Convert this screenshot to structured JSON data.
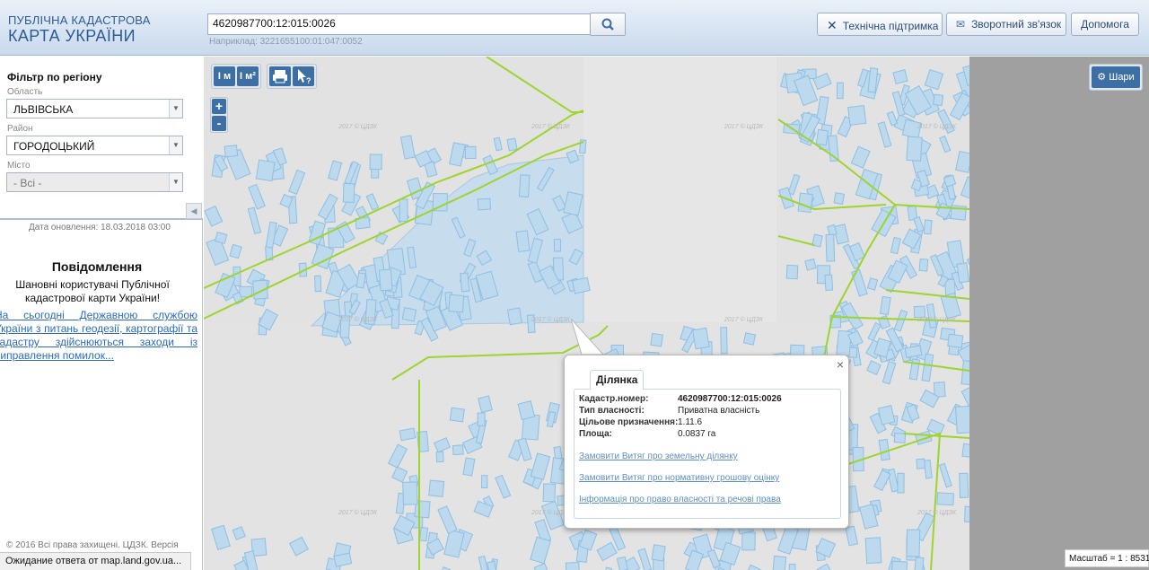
{
  "header": {
    "logo_line1": "ПУБЛІЧНА КАДАСТРОВА",
    "logo_line2": "КАРТА УКРАЇНИ",
    "search_value": "4620987700:12:015:0026",
    "search_hint": "Наприклад: 3221655100:01:047:0052",
    "search_icon": "search-icon",
    "buttons": [
      {
        "label": "Технічна підтримка",
        "icon": "tools-icon"
      },
      {
        "label": "Зворотний зв'язок",
        "icon": "envelope-icon"
      },
      {
        "label": "Допомога"
      }
    ]
  },
  "sidebar": {
    "filter_title": "Фільтр по регіону",
    "region_label": "Область",
    "region_value": "ЛЬВІВСЬКА",
    "district_label": "Район",
    "district_value": "ГОРОДОЦЬКИЙ",
    "city_label": "Місто",
    "city_value": "- Всі -",
    "update_date": "Дата оновлення: 18.03.2018 03:00",
    "notice_title": "Повідомлення",
    "notice_body": "Шановні користувачі Публічної кадастрової карти України!",
    "notice_link": "На сьогодні Державною службою України з питань геодезії, картографії та кадастру здійснюються заходи із виправлення помилок...",
    "copyright": "© 2016 Всі права захищені. ЦДЗК. Версія"
  },
  "toolbar": {
    "measure_length": "I м",
    "measure_area": "I м²",
    "print_icon": "print-icon",
    "identify_icon": "pointer-question-icon",
    "zoom_in": "+",
    "zoom_out": "-"
  },
  "map": {
    "watermark": "2017 © ЦДЗК",
    "layers_label": "Шари",
    "scale": "Масштаб = 1 : 8531",
    "accent": "#3e6fa4",
    "parcel_color": "#bcd9ee",
    "boundary_color": "#9ed42f"
  },
  "popup": {
    "tab": "Ділянка",
    "fields": [
      {
        "key": "Кадастр.номер:",
        "value": "4620987700:12:015:0026"
      },
      {
        "key": "Тип власності:",
        "value": "Приватна власність"
      },
      {
        "key": "Цільове призначення:",
        "value": "1.11.6"
      },
      {
        "key": "Площа:",
        "value": "0.0837 га"
      }
    ],
    "links": [
      "Замовити Витяг про земельну ділянку",
      "Замовити Витяг про нормативну грошову оцінку",
      "Інформація про право власності та речові права"
    ],
    "close": "×"
  },
  "status_text": "Ожидание ответа от map.land.gov.ua..."
}
